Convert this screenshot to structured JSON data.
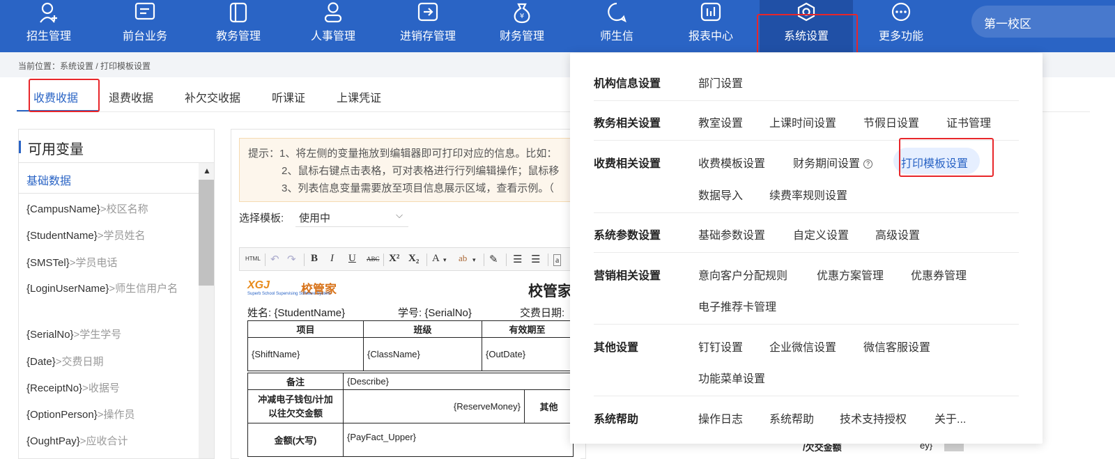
{
  "topnav": {
    "items": [
      {
        "label": "招生管理",
        "icon": "user-add-icon"
      },
      {
        "label": "前台业务",
        "icon": "monitor-icon"
      },
      {
        "label": "教务管理",
        "icon": "book-icon"
      },
      {
        "label": "人事管理",
        "icon": "person-icon"
      },
      {
        "label": "进销存管理",
        "icon": "inventory-icon"
      },
      {
        "label": "财务管理",
        "icon": "money-bag-icon"
      },
      {
        "label": "师生信",
        "icon": "chat-icon"
      },
      {
        "label": "报表中心",
        "icon": "report-chart-icon"
      },
      {
        "label": "系统设置",
        "icon": "settings-icon"
      },
      {
        "label": "更多功能",
        "icon": "more-icon"
      }
    ],
    "active": "系统设置",
    "campus": "第一校区"
  },
  "breadcrumb": "当前位置：系统设置 / 打印模板设置",
  "tabs": [
    "收费收据",
    "退费收据",
    "补欠交收据",
    "听课证",
    "上课凭证"
  ],
  "active_tab": "收费收据",
  "variables_panel": {
    "title": "可用变量",
    "section": "基础数据",
    "items": [
      {
        "key": "{CampusName}",
        "desc": ">校区名称"
      },
      {
        "key": "{StudentName}",
        "desc": ">学员姓名"
      },
      {
        "key": "{SMSTel}",
        "desc": ">学员电话"
      },
      {
        "key": "{LoginUserName}",
        "desc": ">师生信用户名"
      },
      {
        "key": "{SerialNo}",
        "desc": ">学生学号"
      },
      {
        "key": "{Date}",
        "desc": ">交费日期"
      },
      {
        "key": "{ReceiptNo}",
        "desc": ">收据号"
      },
      {
        "key": "{OptionPerson}",
        "desc": ">操作员"
      },
      {
        "key": "{OughtPay}",
        "desc": ">应收合计"
      }
    ]
  },
  "editor": {
    "tips": [
      "提示：1、将左侧的变量拖放到编辑器即可打印对应的信息。比如：",
      "2、鼠标右键点击表格，可对表格进行行列编辑操作；鼠标移",
      "3、列表信息变量需要放至项目信息展示区域，查看示例。（"
    ],
    "template_label": "选择模板:",
    "template_value": "使用中",
    "toolbar": {
      "html": "HTML",
      "bold": "B",
      "italic": "I",
      "underline": "U",
      "strike": "ABC",
      "sup": "X²",
      "sub": "X₂",
      "font_color": "A",
      "highlight": "ab"
    },
    "doc": {
      "logo": "XGJ",
      "logo_name": "校管家",
      "logo_sub": "Superb School Supervising Software System",
      "title": "校管家",
      "name_line": "姓名: {StudentName}",
      "id_line": "学号: {SerialNo}",
      "date_line": "交费日期:",
      "headers": [
        "项目",
        "班级",
        "有效期至"
      ],
      "cells": [
        "{ShiftName}",
        "{ClassName}",
        "{OutDate}"
      ],
      "remark_label": "备注",
      "remark_value": "{Describe}",
      "offset_label_1": "冲减电子钱包/计加",
      "offset_label_2": "以往欠交金额",
      "reserve_money": "{ReserveMoney}",
      "other_frag": "其他",
      "amount_label": "金额(大写)",
      "amount_value": "{PayFact_Upper}",
      "right_frag": "/欠交金额",
      "right_frag2": "ey}"
    }
  },
  "dropdown": {
    "highlighted": "打印模板设置",
    "rows": [
      {
        "category": "机构信息设置",
        "items": [
          "部门设置"
        ]
      },
      {
        "category": "教务相关设置",
        "items": [
          "教室设置",
          "上课时间设置",
          "节假日设置",
          "证书管理"
        ]
      },
      {
        "category": "收费相关设置",
        "items": [
          "收费模板设置",
          "财务期间设置",
          "打印模板设置",
          "数据导入",
          "续费率规则设置"
        ]
      },
      {
        "category": "系统参数设置",
        "items": [
          "基础参数设置",
          "自定义设置",
          "高级设置"
        ]
      },
      {
        "category": "营销相关设置",
        "items": [
          "意向客户分配规则",
          "优惠方案管理",
          "优惠券管理",
          "电子推荐卡管理"
        ]
      },
      {
        "category": "其他设置",
        "items": [
          "钉钉设置",
          "企业微信设置",
          "微信客服设置",
          "功能菜单设置"
        ]
      },
      {
        "category": "系统帮助",
        "items": [
          "操作日志",
          "系统帮助",
          "技术支持授权",
          "关于..."
        ]
      }
    ],
    "help_mark": "?"
  }
}
